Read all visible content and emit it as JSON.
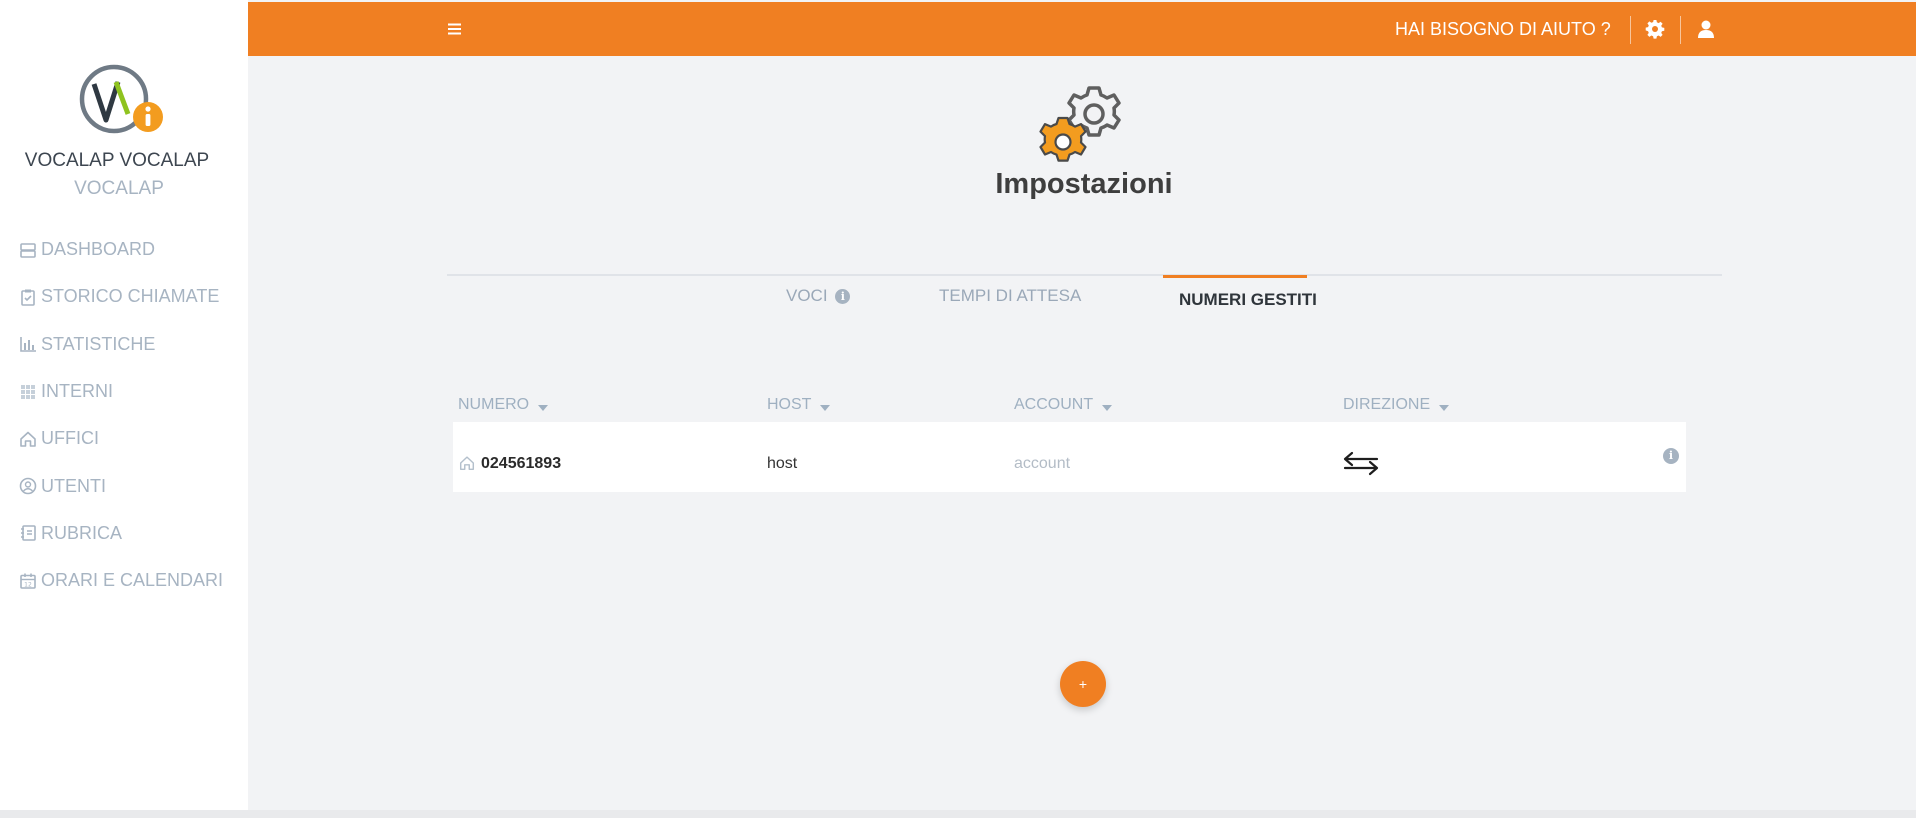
{
  "sidebar": {
    "org_name": "VOCALAP VOCALAP",
    "org_sub": "VOCALAP",
    "items": [
      {
        "label": "DASHBOARD",
        "icon": "dashboard-icon"
      },
      {
        "label": "STORICO CHIAMATE",
        "icon": "clipboard-icon"
      },
      {
        "label": "STATISTICHE",
        "icon": "bar-chart-icon"
      },
      {
        "label": "INTERNI",
        "icon": "grid-icon"
      },
      {
        "label": "UFFICI",
        "icon": "home-icon"
      },
      {
        "label": "UTENTI",
        "icon": "user-circle-icon"
      },
      {
        "label": "RUBRICA",
        "icon": "address-book-icon"
      },
      {
        "label": "ORARI E CALENDARI",
        "icon": "calendar-icon"
      }
    ]
  },
  "topbar": {
    "help_label": "HAI BISOGNO DI AIUTO ?",
    "color": "#f07f22"
  },
  "page": {
    "title": "Impostazioni"
  },
  "tabs": [
    {
      "label": "VOCI",
      "active": false,
      "has_info": true
    },
    {
      "label": "TEMPI DI ATTESA",
      "active": false,
      "has_info": false
    },
    {
      "label": "NUMERI GESTITI",
      "active": true,
      "has_info": false
    }
  ],
  "table": {
    "columns": [
      "NUMERO",
      "HOST",
      "ACCOUNT",
      "DIREZIONE"
    ],
    "rows": [
      {
        "numero": "024561893",
        "host": "host",
        "account": "account",
        "direzione_icon": "bidirectional-arrows-icon"
      }
    ]
  },
  "fab": {
    "label": "+"
  },
  "colors": {
    "accent": "#f07f22",
    "muted": "#a7b4c2",
    "background": "#f2f3f5"
  }
}
